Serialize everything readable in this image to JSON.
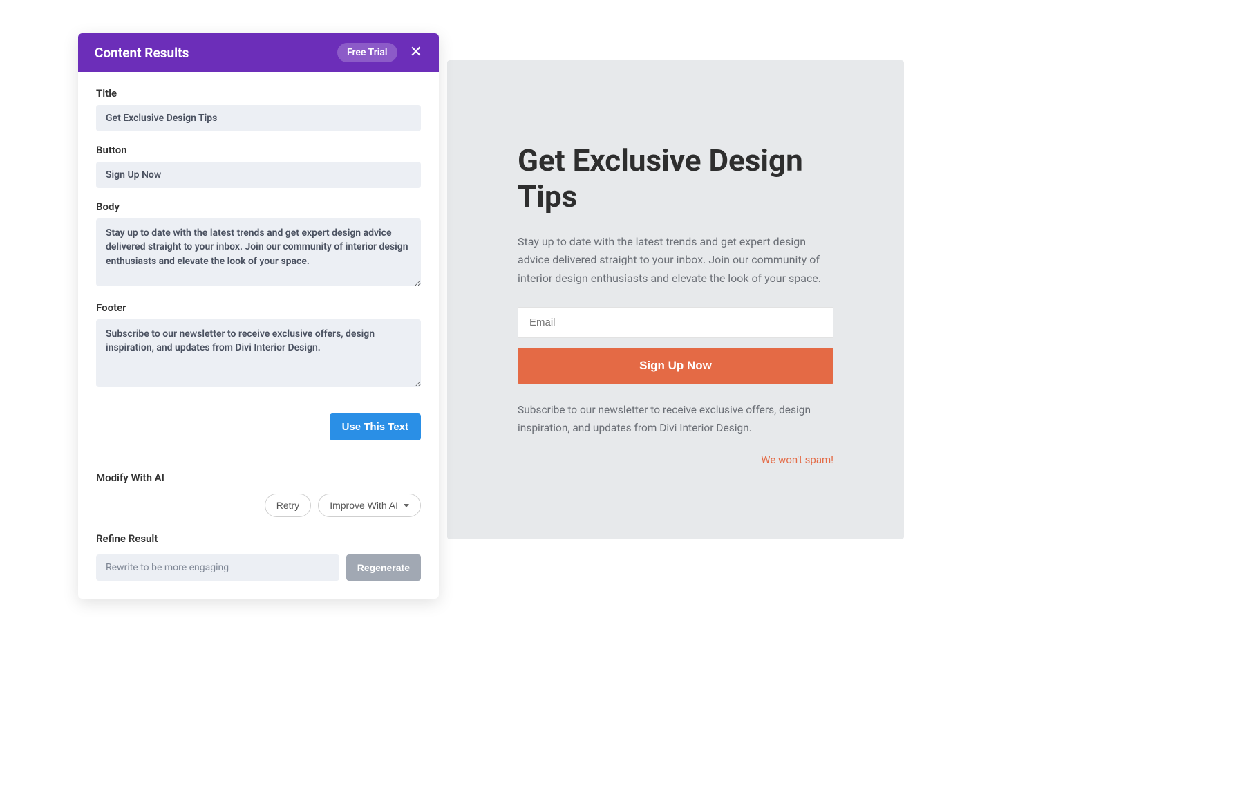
{
  "panel": {
    "title": "Content Results",
    "free_trial": "Free Trial",
    "fields": {
      "title": {
        "label": "Title",
        "value": "Get Exclusive Design Tips"
      },
      "button": {
        "label": "Button",
        "value": "Sign Up Now"
      },
      "body": {
        "label": "Body",
        "value": "Stay up to date with the latest trends and get expert design advice delivered straight to your inbox. Join our community of interior design enthusiasts and elevate the look of your space."
      },
      "footer": {
        "label": "Footer",
        "value": "Subscribe to our newsletter to receive exclusive offers, design inspiration, and updates from Divi Interior Design."
      }
    },
    "use_this_text": "Use This Text",
    "modify_label": "Modify With AI",
    "retry": "Retry",
    "improve": "Improve With AI",
    "refine_label": "Refine Result",
    "refine_placeholder": "Rewrite to be more engaging",
    "regenerate": "Regenerate"
  },
  "preview": {
    "title": "Get Exclusive Design Tips",
    "body": "Stay up to date with the latest trends and get expert design advice delivered straight to your inbox. Join our community of interior design enthusiasts and elevate the look of your space.",
    "email_placeholder": "Email",
    "signup": "Sign Up Now",
    "footer": "Subscribe to our newsletter to receive exclusive offers, design inspiration, and updates from Divi Interior Design.",
    "no_spam": "We won't spam!"
  },
  "colors": {
    "accent_purple": "#6c2eb9",
    "accent_orange": "#e46a45",
    "action_blue": "#2a8fe6"
  }
}
